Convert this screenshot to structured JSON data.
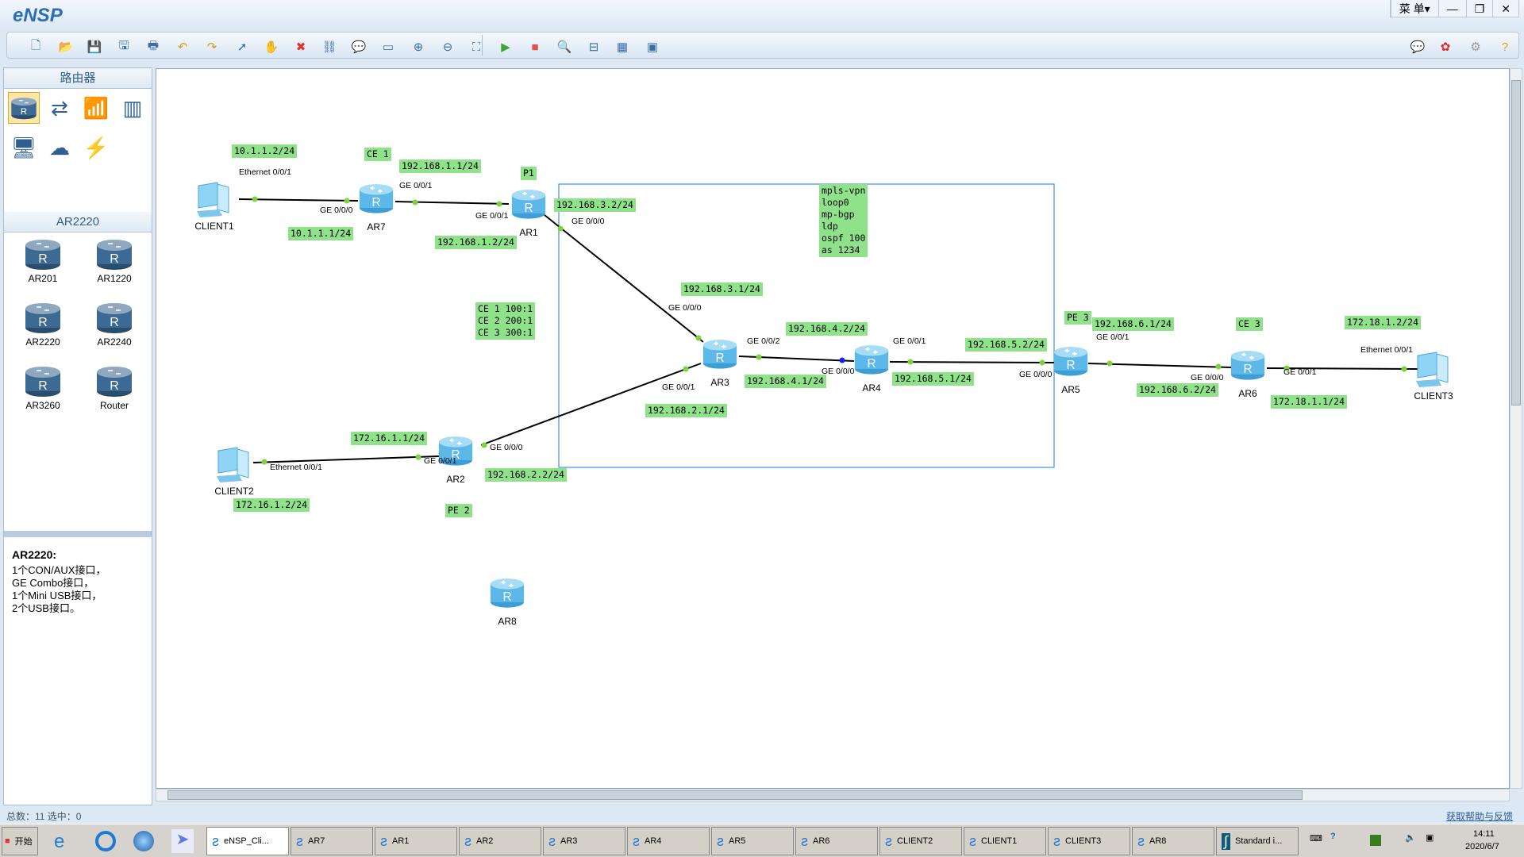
{
  "app": {
    "title": "eNSP",
    "menu_label": "菜 单▾",
    "minimize": "—",
    "restore": "❐",
    "close": "✕"
  },
  "toolbar": {
    "left_icons": [
      "new-topology",
      "open-file",
      "save",
      "save-as",
      "print",
      "undo",
      "redo",
      "select-pointer",
      "pan-hand",
      "delete",
      "delete-all-links",
      "text-annotation",
      "rectangle-shape",
      "zoom-in",
      "zoom-out",
      "fit-to-window",
      "start-device",
      "stop-device",
      "capture-packets",
      "show-interfaces",
      "topology-grid",
      "console-window"
    ],
    "right_icons": [
      "feedback-chat",
      "huawei-logo",
      "settings-gear",
      "help"
    ]
  },
  "palette": {
    "category_title": "路由器",
    "categories": [
      "router",
      "switch",
      "wireless",
      "firewall",
      "pc-terminal",
      "cloud",
      "link-connector"
    ],
    "selected_category": "router",
    "model_title": "AR2220",
    "models": [
      "AR201",
      "AR1220",
      "AR2220",
      "AR2240",
      "AR3260",
      "Router"
    ]
  },
  "info": {
    "title": "AR2220:",
    "lines": [
      "1个CON/AUX接口，",
      "GE Combo接口，",
      "1个Mini USB接口，",
      "2个USB接口。"
    ]
  },
  "topology": {
    "devices": [
      {
        "name": "CLIENT1",
        "type": "pc"
      },
      {
        "name": "AR7",
        "type": "router"
      },
      {
        "name": "AR1",
        "type": "router"
      },
      {
        "name": "AR3",
        "type": "router"
      },
      {
        "name": "AR4",
        "type": "router"
      },
      {
        "name": "AR5",
        "type": "router"
      },
      {
        "name": "AR6",
        "type": "router"
      },
      {
        "name": "CLIENT3",
        "type": "pc"
      },
      {
        "name": "CLIENT2",
        "type": "pc"
      },
      {
        "name": "AR2",
        "type": "router"
      },
      {
        "name": "AR8",
        "type": "router"
      }
    ],
    "links": [
      [
        "CLIENT1",
        "AR7"
      ],
      [
        "AR7",
        "AR1"
      ],
      [
        "AR1",
        "AR3"
      ],
      [
        "AR3",
        "AR4"
      ],
      [
        "AR4",
        "AR5"
      ],
      [
        "AR5",
        "AR6"
      ],
      [
        "AR6",
        "CLIENT3"
      ],
      [
        "CLIENT2",
        "AR2"
      ],
      [
        "AR2",
        "AR3"
      ]
    ],
    "notes": [
      "10.1.1.2/24",
      "CE 1",
      "192.168.1.1/24",
      "P1",
      "192.168.3.2/24",
      "10.1.1.1/24",
      "192.168.1.2/24",
      "mpls-vpn\nloop0\nmp-bgp\nldp\nospf 100\nas 1234",
      "192.168.3.1/24",
      "CE 1 100:1\nCE 2 200:1\nCE 3 300:1",
      "192.168.4.2/24",
      "192.168.5.2/24",
      "PE 3",
      "192.168.6.1/24",
      "CE 3",
      "172.18.1.2/24",
      "192.168.4.1/24",
      "192.168.5.1/24",
      "192.168.6.2/24",
      "172.18.1.1/24",
      "192.168.2.1/24",
      "172.16.1.1/24",
      "192.168.2.2/24",
      "172.16.1.2/24",
      "PE 2"
    ],
    "interfaces": [
      "Ethernet 0/0/1",
      "GE 0/0/0",
      "GE 0/0/1",
      "GE 0/0/1",
      "GE 0/0/0",
      "GE 0/0/0",
      "GE 0/0/2",
      "GE 0/0/1",
      "GE 0/0/0",
      "GE 0/0/1",
      "GE 0/0/0",
      "GE 0/0/1",
      "GE 0/0/0",
      "GE 0/0/1",
      "Ethernet 0/0/1",
      "Ethernet 0/0/1",
      "GE 0/0/1",
      "GE 0/0/0"
    ],
    "colors": {
      "note_bg": "#8fe28a",
      "link": "#000000",
      "port_up": "#7ed23a",
      "port_selected": "#1a1aff",
      "area_box": "#3d8fe8"
    }
  },
  "status": {
    "text": "总数：11  选中：0",
    "help_link": "获取帮助与反馈"
  },
  "taskbar": {
    "start": "开始",
    "items": [
      "eNSP_Cli...",
      "AR7",
      "AR1",
      "AR2",
      "AR3",
      "AR4",
      "AR5",
      "AR6",
      "CLIENT2",
      "CLIENT1",
      "CLIENT3",
      "AR8",
      "Standard i..."
    ],
    "active": "eNSP_Cli...",
    "time": "14:11",
    "date": "2020/6/7"
  }
}
